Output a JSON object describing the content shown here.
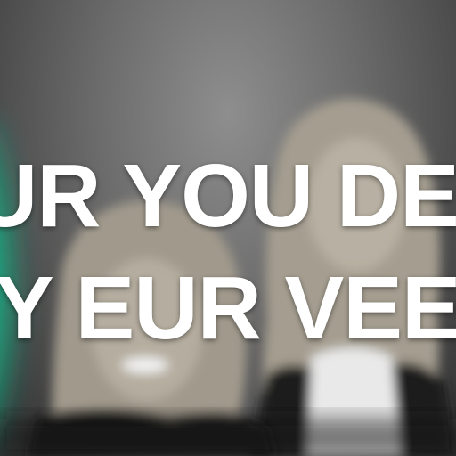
{
  "caption": {
    "line1": "UR YOU DEN",
    "line2": "Y EUR VEED"
  },
  "colors": {
    "text": "#ffffff",
    "accent_glow": "#22c79a",
    "background": "#6c6c6c"
  },
  "scene": {
    "subject_1": "blonde-woman-left",
    "subject_2": "blonde-woman-right"
  }
}
